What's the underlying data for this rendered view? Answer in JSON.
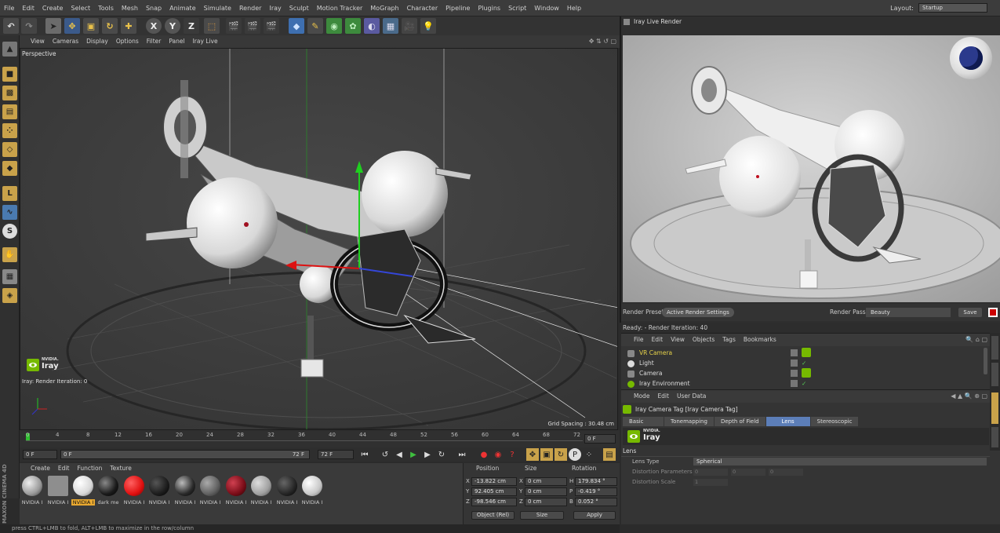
{
  "menubar": {
    "items": [
      "File",
      "Edit",
      "Create",
      "Select",
      "Tools",
      "Mesh",
      "Snap",
      "Animate",
      "Simulate",
      "Render",
      "Iray",
      "Sculpt",
      "Motion Tracker",
      "MoGraph",
      "Character",
      "Pipeline",
      "Plugins",
      "Script",
      "Window",
      "Help"
    ],
    "layout_label": "Layout:",
    "layout_value": "Startup"
  },
  "toolbar": {
    "axis_x": "X",
    "axis_y": "Y",
    "axis_z": "Z"
  },
  "viewport": {
    "menu": [
      "View",
      "Cameras",
      "Display",
      "Options",
      "Filter",
      "Panel",
      "Iray Live"
    ],
    "name": "Perspective",
    "iray_brand_small": "NVIDIA.",
    "iray_brand": "Iray",
    "iteration": "Iray: Render Iteration: 0",
    "grid_spacing": "Grid Spacing : 30.48 cm"
  },
  "timeline": {
    "ticks": [
      "0",
      "4",
      "8",
      "12",
      "16",
      "20",
      "24",
      "28",
      "32",
      "36",
      "40",
      "44",
      "48",
      "52",
      "56",
      "60",
      "64",
      "68",
      "72"
    ],
    "end_field": "0 F"
  },
  "transport": {
    "start": "0 F",
    "current": "0 F",
    "end_a": "72 F",
    "end_b": "72 F"
  },
  "materials": {
    "menu": [
      "Create",
      "Edit",
      "Function",
      "Texture"
    ],
    "items": [
      {
        "name": "NVIDIA I",
        "color": "#9a9a9a"
      },
      {
        "name": "NVIDIA I",
        "color": "#8e8e8e"
      },
      {
        "name": "NVIDIA I",
        "color": "#d8d8d8"
      },
      {
        "name": "dark me",
        "color": "#1a1a1a"
      },
      {
        "name": "NVIDIA I",
        "color": "#e01010"
      },
      {
        "name": "NVIDIA I",
        "color": "#1c1c1c"
      },
      {
        "name": "NVIDIA I",
        "color": "#2a2a2a"
      },
      {
        "name": "NVIDIA I",
        "color": "#606060"
      },
      {
        "name": "NVIDIA I",
        "color": "#7a0d18"
      },
      {
        "name": "NVIDIA I",
        "color": "#a0a0a0"
      },
      {
        "name": "NVIDIA I",
        "color": "#252525"
      },
      {
        "name": "NVIDIA I",
        "color": "#c8c8c8"
      }
    ]
  },
  "coords": {
    "headers": [
      "Position",
      "Size",
      "Rotation"
    ],
    "rows": [
      {
        "axis": "X",
        "pos": "-13.822 cm",
        "saxis": "X",
        "size": "0 cm",
        "raxis": "H",
        "rot": "179.834 °"
      },
      {
        "axis": "Y",
        "pos": "92.405 cm",
        "saxis": "Y",
        "size": "0 cm",
        "raxis": "P",
        "rot": "-0.419 °"
      },
      {
        "axis": "Z",
        "pos": "-98.546 cm",
        "saxis": "Z",
        "size": "0 cm",
        "raxis": "B",
        "rot": "0.052 °"
      }
    ],
    "mode": "Object (Rel)",
    "size_mode": "Size",
    "apply": "Apply"
  },
  "status": "press CTRL+LMB to fold, ALT+LMB to maximize in the row/column",
  "maxon": "MAXON CINEMA 4D",
  "render": {
    "title": "Iray Live Render",
    "preset_label": "Render Preset",
    "preset_value": "Active Render Settings",
    "pass_label": "Render Pass",
    "pass_value": "Beauty",
    "save": "Save",
    "iteration": "Ready: - Render Iteration: 40"
  },
  "objects": {
    "menu": [
      "File",
      "Edit",
      "View",
      "Objects",
      "Tags",
      "Bookmarks"
    ],
    "items": [
      {
        "name": "VR Camera",
        "color": "#e6d24a"
      },
      {
        "name": "Light",
        "color": "#dddddd"
      },
      {
        "name": "Camera",
        "color": "#dddddd"
      },
      {
        "name": "Iray Environment",
        "color": "#dddddd"
      }
    ]
  },
  "attributes": {
    "menu": [
      "Mode",
      "Edit",
      "User Data"
    ],
    "title": "Iray Camera Tag [Iray Camera Tag]",
    "tabs": [
      "Basic",
      "Tonemapping",
      "Depth of Field",
      "Lens",
      "Stereoscopic"
    ],
    "active_tab": "Lens",
    "section": "Lens",
    "lens_type_label": "Lens Type",
    "lens_type_value": "Spherical",
    "distortion_params_label": "Distortion Parameters",
    "distortion_params": [
      "0",
      "0",
      "0"
    ],
    "distortion_scale_label": "Distortion Scale",
    "distortion_scale": "1"
  },
  "colors": {
    "accent": "#5c7eb8",
    "nvidia_green": "#76b900",
    "cinema_blue": "#2b3a8c"
  }
}
